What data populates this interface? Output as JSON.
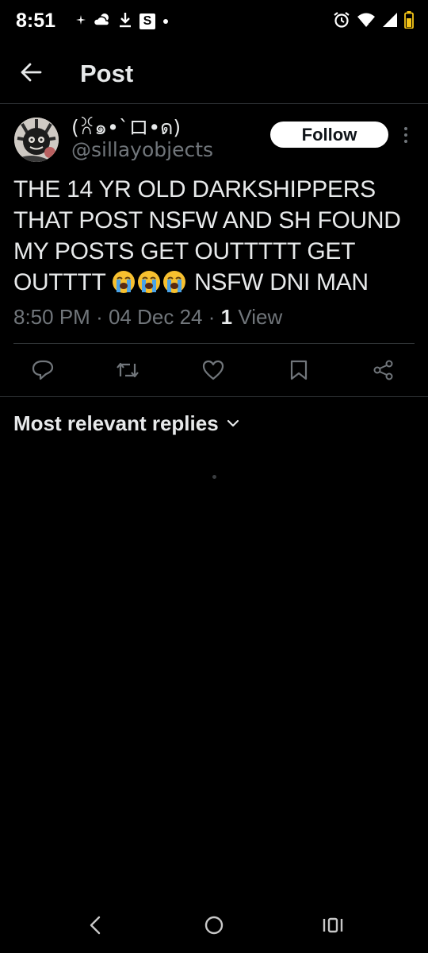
{
  "status_bar": {
    "time": "8:51",
    "left_icons": [
      "sparkle-icon",
      "weather-icon",
      "download-icon",
      "s-app-icon",
      "dot-icon"
    ],
    "s_app_label": "S",
    "right_icons": [
      "alarm-icon",
      "wifi-icon",
      "signal-icon",
      "battery-icon"
    ],
    "battery_color": "#f5c518"
  },
  "header": {
    "title": "Post",
    "back_icon": "arrow-left-icon"
  },
  "post": {
    "display_name": "(ꐦ๑•`ロ•ด)",
    "handle": "@sillayobjects",
    "follow_label": "Follow",
    "text_before_emoji": "THE 14 YR OLD DARKSHIPPERS THAT POST NSFW AND SH FOUND MY POSTS GET OUTTTTT GET OUTTTT",
    "emoji_name": "loudly-crying-face-icon",
    "text_after_emoji": "NSFW DNI MAN",
    "time": "8:50 PM",
    "separator": "·",
    "date": "04 Dec 24",
    "views_count": "1",
    "views_label": "View"
  },
  "actions": [
    "reply-icon",
    "repost-icon",
    "like-icon",
    "bookmark-icon",
    "share-icon"
  ],
  "replies": {
    "sort_label": "Most relevant replies"
  },
  "nav_bar": [
    "back-nav-icon",
    "home-nav-icon",
    "recents-nav-icon"
  ],
  "colors": {
    "background": "#000000",
    "text_primary": "#e7e9ea",
    "text_secondary": "#71767b",
    "divider": "#2f3336",
    "follow_bg": "#ffffff"
  }
}
